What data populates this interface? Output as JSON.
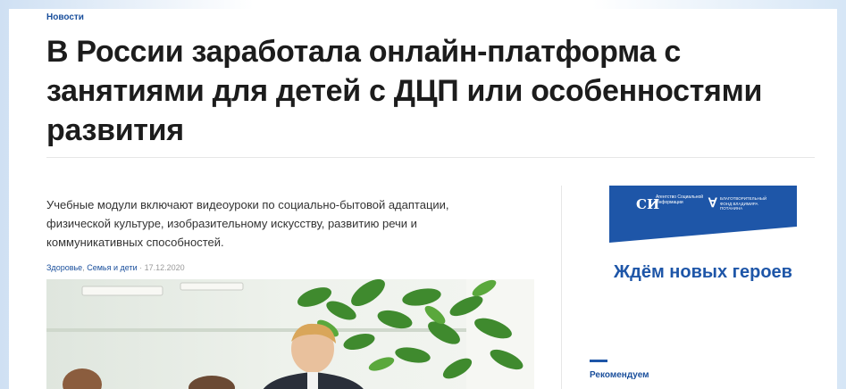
{
  "header": {
    "section_label": "Новости"
  },
  "article": {
    "title": "В России заработала онлайн-платформа с занятиями для детей с ДЦП или особенностями развития",
    "lead": "Учебные модули включают видеоуроки по социально-бытовой адаптации, физической культуре, изобразительному искусству, развитию речи и коммуникативных способностей.",
    "tags": [
      "Здоровье",
      "Семья и дети"
    ],
    "tag_separator": ",",
    "date_separator": " · ",
    "date": "17.12.2020"
  },
  "sidebar": {
    "banner": {
      "logo1_mark": "СИ",
      "logo1_text": "Агентство Социальной Информации",
      "logo2_mark": "∀",
      "logo2_text": "БЛАГОТВОРИТЕЛЬНЫЙ ФОНД ВЛАДИМИРА ПОТАНИНА",
      "bg_color": "#1e56a8"
    },
    "promo_text": "Ждём новых героев",
    "recommend_label": "Рекомендуем"
  },
  "colors": {
    "accent": "#1e56a8",
    "link": "#1a4f9c",
    "title": "#1c1c1c"
  }
}
